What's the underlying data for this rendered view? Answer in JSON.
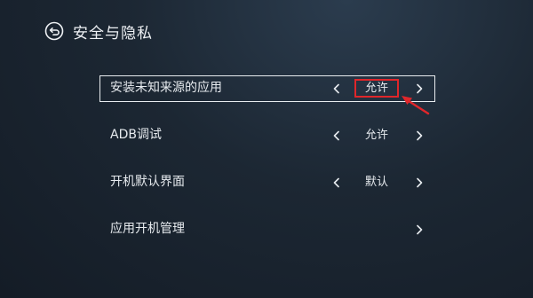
{
  "header": {
    "back_icon": "back-arrow-circle-icon",
    "title": "安全与隐私"
  },
  "settings": {
    "rows": [
      {
        "label": "安装未知来源的应用",
        "value": "允许",
        "has_left_arrow": true,
        "has_right_arrow": true,
        "selected": true,
        "highlighted": true
      },
      {
        "label": "ADB调试",
        "value": "允许",
        "has_left_arrow": true,
        "has_right_arrow": true,
        "selected": false
      },
      {
        "label": "开机默认界面",
        "value": "默认",
        "has_left_arrow": true,
        "has_right_arrow": true,
        "selected": false
      },
      {
        "label": "应用开机管理",
        "value": "",
        "has_left_arrow": false,
        "has_right_arrow": true,
        "selected": false
      }
    ]
  },
  "annotation": {
    "highlight_color": "#e0262a",
    "arrow_icon": "red-pointer-arrow-icon"
  },
  "colors": {
    "background": "#1c2733",
    "text": "#e6eaee",
    "selection_border": "#e9edf0"
  }
}
